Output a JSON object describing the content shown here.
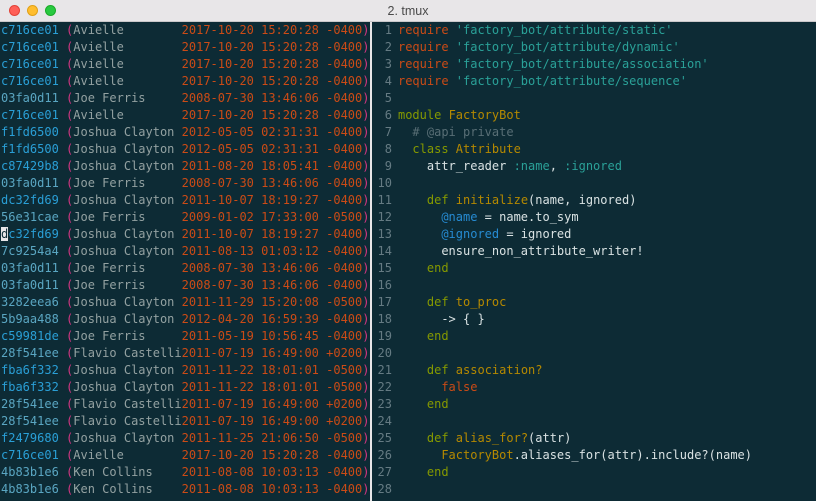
{
  "window": {
    "title": "2. tmux"
  },
  "colors": {
    "bg": "#0d2b35",
    "hash": "#2a9fd6",
    "hash_alt": "#5aa6c2",
    "paren": "#d33682",
    "name": "#93a1a1",
    "timestamp": "#cb4b16",
    "lineno": "#657b83",
    "keyword": "#cb4b16",
    "string": "#2aa198",
    "keyword2": "#859900",
    "type": "#b58900",
    "symbol": "#2aa198",
    "ivar": "#268bd2",
    "bool": "#cb4b16",
    "comment": "#586e75",
    "normal": "#d9e2e3"
  },
  "blame": [
    {
      "hash": "c716ce01",
      "author": "Avielle",
      "ts": "2017-10-20 15:20:28 -0400"
    },
    {
      "hash": "c716ce01",
      "author": "Avielle",
      "ts": "2017-10-20 15:20:28 -0400"
    },
    {
      "hash": "c716ce01",
      "author": "Avielle",
      "ts": "2017-10-20 15:20:28 -0400"
    },
    {
      "hash": "c716ce01",
      "author": "Avielle",
      "ts": "2017-10-20 15:20:28 -0400"
    },
    {
      "hash": "03fa0d11",
      "author": "Joe Ferris",
      "ts": "2008-07-30 13:46:06 -0400"
    },
    {
      "hash": "c716ce01",
      "author": "Avielle",
      "ts": "2017-10-20 15:20:28 -0400"
    },
    {
      "hash": "f1fd6500",
      "author": "Joshua Clayton",
      "ts": "2012-05-05 02:31:31 -0400"
    },
    {
      "hash": "f1fd6500",
      "author": "Joshua Clayton",
      "ts": "2012-05-05 02:31:31 -0400"
    },
    {
      "hash": "c87429b8",
      "author": "Joshua Clayton",
      "ts": "2011-08-20 18:05:41 -0400"
    },
    {
      "hash": "03fa0d11",
      "author": "Joe Ferris",
      "ts": "2008-07-30 13:46:06 -0400"
    },
    {
      "hash": "dc32fd69",
      "author": "Joshua Clayton",
      "ts": "2011-10-07 18:19:27 -0400"
    },
    {
      "hash": "56e31cae",
      "author": "Joe Ferris",
      "ts": "2009-01-02 17:33:00 -0500"
    },
    {
      "hash": "dc32fd69",
      "author": "Joshua Clayton",
      "ts": "2011-10-07 18:19:27 -0400",
      "cursor": true
    },
    {
      "hash": "7c9254a4",
      "author": "Joshua Clayton",
      "ts": "2011-08-13 01:03:12 -0400"
    },
    {
      "hash": "03fa0d11",
      "author": "Joe Ferris",
      "ts": "2008-07-30 13:46:06 -0400"
    },
    {
      "hash": "03fa0d11",
      "author": "Joe Ferris",
      "ts": "2008-07-30 13:46:06 -0400"
    },
    {
      "hash": "3282eea6",
      "author": "Joshua Clayton",
      "ts": "2011-11-29 15:20:08 -0500"
    },
    {
      "hash": "5b9aa488",
      "author": "Joshua Clayton",
      "ts": "2012-04-20 16:59:39 -0400"
    },
    {
      "hash": "c59981de",
      "author": "Joe Ferris",
      "ts": "2011-05-19 10:56:45 -0400"
    },
    {
      "hash": "28f541ee",
      "author": "Flavio Castelli",
      "ts": "2011-07-19 16:49:00 +0200"
    },
    {
      "hash": "fba6f332",
      "author": "Joshua Clayton",
      "ts": "2011-11-22 18:01:01 -0500"
    },
    {
      "hash": "fba6f332",
      "author": "Joshua Clayton",
      "ts": "2011-11-22 18:01:01 -0500"
    },
    {
      "hash": "28f541ee",
      "author": "Flavio Castelli",
      "ts": "2011-07-19 16:49:00 +0200"
    },
    {
      "hash": "28f541ee",
      "author": "Flavio Castelli",
      "ts": "2011-07-19 16:49:00 +0200"
    },
    {
      "hash": "f2479680",
      "author": "Joshua Clayton",
      "ts": "2011-11-25 21:06:50 -0500"
    },
    {
      "hash": "c716ce01",
      "author": "Avielle",
      "ts": "2017-10-20 15:20:28 -0400"
    },
    {
      "hash": "4b83b1e6",
      "author": "Ken Collins",
      "ts": "2011-08-08 10:03:13 -0400"
    },
    {
      "hash": "4b83b1e6",
      "author": "Ken Collins",
      "ts": "2011-08-08 10:03:13 -0400"
    }
  ],
  "code": [
    {
      "n": 1,
      "tokens": [
        [
          "kw",
          "require"
        ],
        [
          "norm",
          " "
        ],
        [
          "str",
          "'factory_bot/attribute/static'"
        ]
      ]
    },
    {
      "n": 2,
      "tokens": [
        [
          "kw",
          "require"
        ],
        [
          "norm",
          " "
        ],
        [
          "str",
          "'factory_bot/attribute/dynamic'"
        ]
      ]
    },
    {
      "n": 3,
      "tokens": [
        [
          "kw",
          "require"
        ],
        [
          "norm",
          " "
        ],
        [
          "str",
          "'factory_bot/attribute/association'"
        ]
      ]
    },
    {
      "n": 4,
      "tokens": [
        [
          "kw",
          "require"
        ],
        [
          "norm",
          " "
        ],
        [
          "str",
          "'factory_bot/attribute/sequence'"
        ]
      ]
    },
    {
      "n": 5,
      "tokens": []
    },
    {
      "n": 6,
      "tokens": [
        [
          "kw2",
          "module"
        ],
        [
          "norm",
          " "
        ],
        [
          "type",
          "FactoryBot"
        ]
      ]
    },
    {
      "n": 7,
      "tokens": [
        [
          "norm",
          "  "
        ],
        [
          "cmt",
          "# @api private"
        ]
      ]
    },
    {
      "n": 8,
      "tokens": [
        [
          "norm",
          "  "
        ],
        [
          "kw2",
          "class"
        ],
        [
          "norm",
          " "
        ],
        [
          "type",
          "Attribute"
        ]
      ]
    },
    {
      "n": 9,
      "tokens": [
        [
          "norm",
          "    "
        ],
        [
          "norm",
          "attr_reader "
        ],
        [
          "sym",
          ":name"
        ],
        [
          "norm",
          ", "
        ],
        [
          "sym",
          ":ignored"
        ]
      ]
    },
    {
      "n": 10,
      "tokens": []
    },
    {
      "n": 11,
      "tokens": [
        [
          "norm",
          "    "
        ],
        [
          "kw2",
          "def"
        ],
        [
          "norm",
          " "
        ],
        [
          "type",
          "initialize"
        ],
        [
          "norm",
          "(name, ignored)"
        ]
      ]
    },
    {
      "n": 12,
      "tokens": [
        [
          "norm",
          "      "
        ],
        [
          "var",
          "@name"
        ],
        [
          "norm",
          " = name.to_sym"
        ]
      ]
    },
    {
      "n": 13,
      "tokens": [
        [
          "norm",
          "      "
        ],
        [
          "var",
          "@ignored"
        ],
        [
          "norm",
          " = ignored"
        ]
      ]
    },
    {
      "n": 14,
      "tokens": [
        [
          "norm",
          "      ensure_non_attribute_writer!"
        ]
      ]
    },
    {
      "n": 15,
      "tokens": [
        [
          "norm",
          "    "
        ],
        [
          "kw2",
          "end"
        ]
      ]
    },
    {
      "n": 16,
      "tokens": []
    },
    {
      "n": 17,
      "tokens": [
        [
          "norm",
          "    "
        ],
        [
          "kw2",
          "def"
        ],
        [
          "norm",
          " "
        ],
        [
          "type",
          "to_proc"
        ]
      ]
    },
    {
      "n": 18,
      "tokens": [
        [
          "norm",
          "      -> { }"
        ]
      ]
    },
    {
      "n": 19,
      "tokens": [
        [
          "norm",
          "    "
        ],
        [
          "kw2",
          "end"
        ]
      ]
    },
    {
      "n": 20,
      "tokens": []
    },
    {
      "n": 21,
      "tokens": [
        [
          "norm",
          "    "
        ],
        [
          "kw2",
          "def"
        ],
        [
          "norm",
          " "
        ],
        [
          "type",
          "association?"
        ]
      ]
    },
    {
      "n": 22,
      "tokens": [
        [
          "norm",
          "      "
        ],
        [
          "bool",
          "false"
        ]
      ]
    },
    {
      "n": 23,
      "tokens": [
        [
          "norm",
          "    "
        ],
        [
          "kw2",
          "end"
        ]
      ]
    },
    {
      "n": 24,
      "tokens": []
    },
    {
      "n": 25,
      "tokens": [
        [
          "norm",
          "    "
        ],
        [
          "kw2",
          "def"
        ],
        [
          "norm",
          " "
        ],
        [
          "type",
          "alias_for?"
        ],
        [
          "norm",
          "(attr)"
        ]
      ]
    },
    {
      "n": 26,
      "tokens": [
        [
          "norm",
          "      "
        ],
        [
          "type",
          "FactoryBot"
        ],
        [
          "norm",
          ".aliases_for(attr).include?(name)"
        ]
      ]
    },
    {
      "n": 27,
      "tokens": [
        [
          "norm",
          "    "
        ],
        [
          "kw2",
          "end"
        ]
      ]
    },
    {
      "n": 28,
      "tokens": []
    }
  ]
}
